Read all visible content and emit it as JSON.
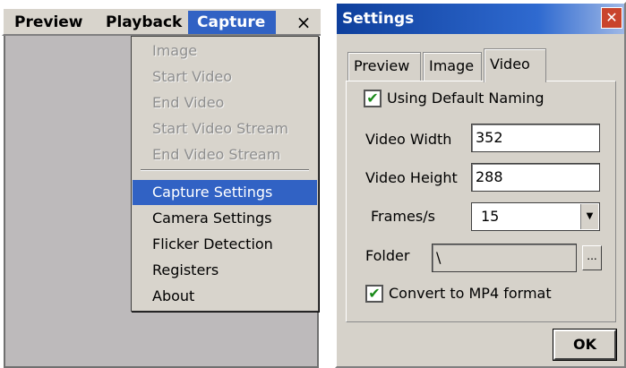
{
  "menu_bar": {
    "items": [
      {
        "label": "Preview"
      },
      {
        "label": "Playback"
      },
      {
        "label": "Capture"
      }
    ],
    "close_label": "×"
  },
  "capture_menu": {
    "disabled_items": [
      "Image",
      "Start Video",
      "End Video",
      "Start Video Stream",
      "End Video Stream"
    ],
    "enabled_items": [
      "Capture Settings",
      "Camera Settings",
      "Flicker Detection",
      "Registers",
      "About"
    ],
    "selected": "Capture Settings"
  },
  "settings_dialog": {
    "title": "Settings",
    "close_label": "✕",
    "tabs": [
      {
        "label": "Preview"
      },
      {
        "label": "Image"
      },
      {
        "label": "Video"
      }
    ],
    "active_tab": "Video",
    "using_default_naming": {
      "label": "Using Default Naming",
      "checked": true
    },
    "video_width": {
      "label": "Video Width",
      "value": "352"
    },
    "video_height": {
      "label": "Video Height",
      "value": "288"
    },
    "frames": {
      "label": "Frames/s",
      "value": "15"
    },
    "folder": {
      "label": "Folder",
      "value": "\\",
      "browse_label": "..."
    },
    "convert_mp4": {
      "label": "Convert to MP4 format",
      "checked": true
    },
    "ok_label": "OK"
  },
  "colors": {
    "highlight": "#3162c4",
    "window_bg": "#d8d4cc",
    "content_bg": "#bdbabb",
    "check_mark": "#1a8a1a"
  },
  "icons": {
    "checkbox_checked": "check-mark-icon",
    "dropdown_arrow": "chevron-down-icon",
    "close": "close-icon"
  }
}
